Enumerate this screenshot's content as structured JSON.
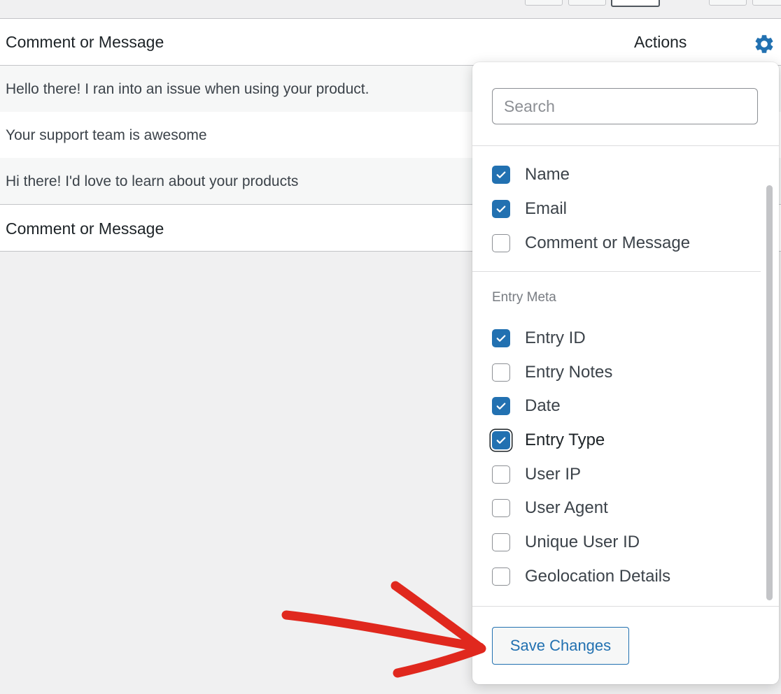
{
  "table": {
    "header": {
      "column": "Comment or Message",
      "actions": "Actions"
    },
    "rows": [
      "Hello there! I ran into an issue when using your product.",
      "Your support team is awesome",
      "Hi there! I'd love to learn about your products"
    ],
    "footer": {
      "column": "Comment or Message"
    }
  },
  "settings_panel": {
    "icon": "gear-icon",
    "search_placeholder": "Search",
    "fields": [
      {
        "label": "Name",
        "checked": true
      },
      {
        "label": "Email",
        "checked": true
      },
      {
        "label": "Comment or Message",
        "checked": false
      }
    ],
    "entry_meta": {
      "heading": "Entry Meta",
      "items": [
        {
          "label": "Entry ID",
          "checked": true
        },
        {
          "label": "Entry Notes",
          "checked": false
        },
        {
          "label": "Date",
          "checked": true
        },
        {
          "label": "Entry Type",
          "checked": true,
          "focused": true
        },
        {
          "label": "User IP",
          "checked": false
        },
        {
          "label": "User Agent",
          "checked": false
        },
        {
          "label": "Unique User ID",
          "checked": false
        },
        {
          "label": "Geolocation Details",
          "checked": false
        }
      ]
    },
    "save_label": "Save Changes"
  },
  "colors": {
    "accent": "#2271b1",
    "annotation": "#e0281e"
  }
}
